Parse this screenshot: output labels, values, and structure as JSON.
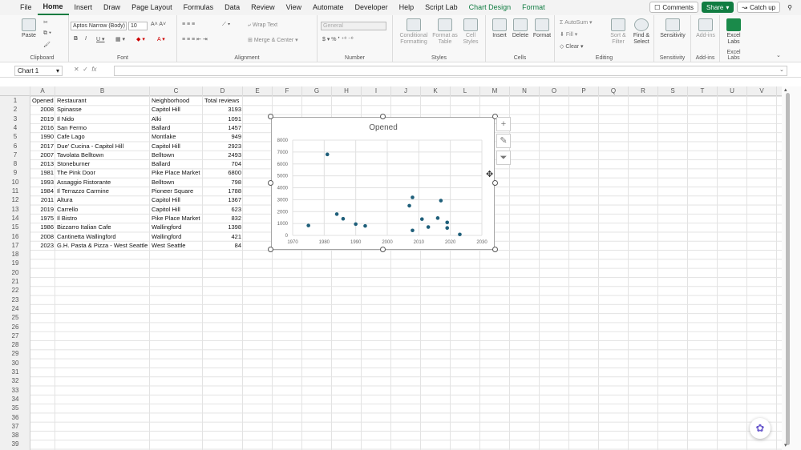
{
  "menu": {
    "tabs": [
      "File",
      "Home",
      "Insert",
      "Draw",
      "Page Layout",
      "Formulas",
      "Data",
      "Review",
      "View",
      "Automate",
      "Developer",
      "Help",
      "Script Lab",
      "Chart Design",
      "Format"
    ],
    "active": "Home",
    "context_tabs": [
      "Chart Design",
      "Format"
    ],
    "comments": "Comments",
    "share": "Share",
    "catchup": "Catch up"
  },
  "ribbon": {
    "clipboard": {
      "paste": "Paste",
      "label": "Clipboard"
    },
    "font": {
      "name": "Aptos Narrow (Body)",
      "size": "10",
      "label": "Font"
    },
    "alignment": {
      "wrap": "Wrap Text",
      "merge": "Merge & Center",
      "label": "Alignment"
    },
    "number": {
      "format": "General",
      "label": "Number"
    },
    "styles": {
      "conditional": "Conditional Formatting",
      "format_table": "Format as Table",
      "cell_styles": "Cell Styles",
      "label": "Styles"
    },
    "cells": {
      "insert": "Insert",
      "delete": "Delete",
      "format": "Format",
      "label": "Cells"
    },
    "editing": {
      "autosum": "AutoSum",
      "fill": "Fill",
      "clear": "Clear",
      "sort": "Sort & Filter",
      "find": "Find & Select",
      "label": "Editing"
    },
    "sensitivity": {
      "btn": "Sensitivity",
      "label": "Sensitivity"
    },
    "addins": {
      "btn": "Add-ins",
      "label": "Add-ins"
    },
    "excel_labs": {
      "btn": "Excel Labs",
      "label": "Excel Labs"
    }
  },
  "formula_bar": {
    "name_box": "Chart 1",
    "fx": "fx",
    "formula": ""
  },
  "columns": [
    "A",
    "B",
    "C",
    "D",
    "E",
    "F",
    "G",
    "H",
    "I",
    "J",
    "K",
    "L",
    "M",
    "N",
    "O",
    "P",
    "Q",
    "R",
    "S",
    "T",
    "U",
    "V"
  ],
  "row_numbers": [
    "1",
    "2",
    "3",
    "4",
    "5",
    "6",
    "7",
    "8",
    "9",
    "10",
    "11",
    "12",
    "13",
    "14",
    "15",
    "16",
    "17",
    "18",
    "19",
    "20",
    "21",
    "22",
    "23",
    "24",
    "25",
    "26",
    "27",
    "28",
    "29",
    "30",
    "31",
    "32",
    "33",
    "34",
    "35",
    "36",
    "37",
    "38",
    "39"
  ],
  "table": {
    "headers": [
      "Opened",
      "Restaurant",
      "Neighborhood",
      "Total reviews"
    ],
    "rows": [
      [
        "2008",
        "Spinasse",
        "Capitol Hill",
        "3193"
      ],
      [
        "2019",
        "Il Nido",
        "Alki",
        "1091"
      ],
      [
        "2016",
        "San Fermo",
        "Ballard",
        "1457"
      ],
      [
        "1990",
        "Cafe Lago",
        "Montlake",
        "949"
      ],
      [
        "2017",
        "Due' Cucina - Capitol Hill",
        "Capitol Hill",
        "2923"
      ],
      [
        "2007",
        "Tavolata Belltown",
        "Belltown",
        "2493"
      ],
      [
        "2013",
        "Stoneburner",
        "Ballard",
        "704"
      ],
      [
        "1981",
        "The Pink Door",
        "Pike Place Market",
        "6800"
      ],
      [
        "1993",
        "Assaggio Ristorante",
        "Belltown",
        "798"
      ],
      [
        "1984",
        "Il Terrazzo Carmine",
        "Pioneer Square",
        "1788"
      ],
      [
        "2011",
        "Altura",
        "Capitol Hill",
        "1367"
      ],
      [
        "2019",
        "Carrello",
        "Capitol Hill",
        "623"
      ],
      [
        "1975",
        "Il Bistro",
        "Pike Place Market",
        "832"
      ],
      [
        "1986",
        "Bizzarro Italian Cafe",
        "Wallingford",
        "1398"
      ],
      [
        "2008",
        "Cantinetta Wallingford",
        "Wallingford",
        "421"
      ],
      [
        "2023",
        "G.H. Pasta & Pizza - West Seattle",
        "West Seattle",
        "84"
      ]
    ]
  },
  "chart_data": {
    "type": "scatter",
    "title": "Opened",
    "xlabel": "",
    "ylabel": "",
    "xlim": [
      1970,
      2030
    ],
    "ylim": [
      0,
      8000
    ],
    "xticks": [
      "1970",
      "1980",
      "1990",
      "2000",
      "2010",
      "2020",
      "2030"
    ],
    "yticks": [
      "0",
      "1000",
      "2000",
      "3000",
      "4000",
      "5000",
      "6000",
      "7000",
      "8000"
    ],
    "grid": true,
    "color": "#1f5f7a",
    "points": [
      [
        2008,
        3193
      ],
      [
        2019,
        1091
      ],
      [
        2016,
        1457
      ],
      [
        1990,
        949
      ],
      [
        2017,
        2923
      ],
      [
        2007,
        2493
      ],
      [
        2013,
        704
      ],
      [
        1981,
        6800
      ],
      [
        1993,
        798
      ],
      [
        1984,
        1788
      ],
      [
        2011,
        1367
      ],
      [
        2019,
        623
      ],
      [
        1975,
        832
      ],
      [
        1986,
        1398
      ],
      [
        2008,
        421
      ],
      [
        2023,
        84
      ]
    ]
  }
}
